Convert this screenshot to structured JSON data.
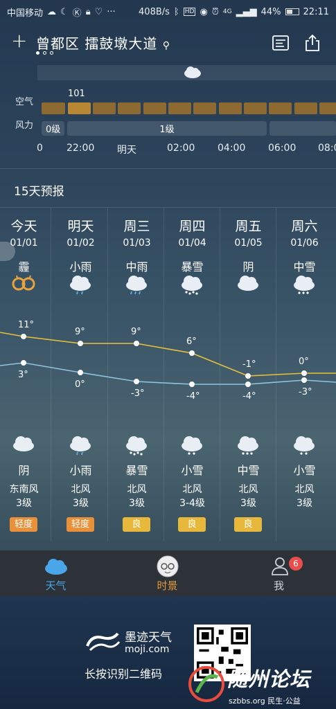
{
  "status_bar": {
    "carrier": "中国移动",
    "speed": "408B/s",
    "net": "4G",
    "battery": "44%",
    "time": "22:11",
    "battery_icon": "battery-icon"
  },
  "header": {
    "location": "曾都区 擂鼓墩大道",
    "add_label": "十"
  },
  "hourly": {
    "aq_label": "空气",
    "wind_label": "力风",
    "wind_label_display": "风力",
    "aqi_value": "101",
    "wind_levels": [
      "0级",
      "1级"
    ],
    "times": [
      "0",
      "22:00",
      "明天",
      "02:00",
      "04:00",
      "06:00",
      "08:0"
    ]
  },
  "forecast": {
    "title": "15天预报",
    "days": [
      {
        "day": "今天",
        "date": "01/01",
        "cond": "霾",
        "hi": "11°",
        "lo": "3°",
        "night": "阴",
        "wind_dir": "东南风",
        "wind_lv": "3级",
        "aqi": "轻度",
        "aqi_color": "#e9913a",
        "day_icon": "haze-icon",
        "night_icon": "cloud-icon"
      },
      {
        "day": "明天",
        "date": "01/02",
        "cond": "小雨",
        "hi": "9°",
        "lo": "0°",
        "night": "小雨",
        "wind_dir": "北风",
        "wind_lv": "3级",
        "aqi": "轻度",
        "aqi_color": "#e9913a",
        "day_icon": "light-rain-icon",
        "night_icon": "light-rain-icon"
      },
      {
        "day": "周三",
        "date": "01/03",
        "cond": "中雨",
        "hi": "9°",
        "lo": "-3°",
        "night": "暴雪",
        "wind_dir": "北风",
        "wind_lv": "3级",
        "aqi": "良",
        "aqi_color": "#e8b83c",
        "day_icon": "moderate-rain-icon",
        "night_icon": "blizzard-icon"
      },
      {
        "day": "周四",
        "date": "01/04",
        "cond": "暴雪",
        "hi": "6°",
        "lo": "-4°",
        "night": "小雪",
        "wind_dir": "北风",
        "wind_lv": "3-4级",
        "aqi": "良",
        "aqi_color": "#e8b83c",
        "day_icon": "blizzard-icon",
        "night_icon": "light-snow-icon"
      },
      {
        "day": "周五",
        "date": "01/05",
        "cond": "阴",
        "hi": "-1°",
        "lo": "-4°",
        "night": "中雪",
        "wind_dir": "北风",
        "wind_lv": "3级",
        "aqi": "良",
        "aqi_color": "#e8b83c",
        "day_icon": "cloud-icon",
        "night_icon": "moderate-snow-icon"
      },
      {
        "day": "周六",
        "date": "01/06",
        "cond": "中雪",
        "hi": "0°",
        "lo": "-3°",
        "night": "小雪",
        "wind_dir": "北风",
        "wind_lv": "3级",
        "aqi": "",
        "aqi_color": "",
        "day_icon": "moderate-snow-icon",
        "night_icon": "light-snow-icon"
      }
    ]
  },
  "tabs": [
    {
      "label": "天气",
      "color": "#4aa6e8"
    },
    {
      "label": "时景",
      "color": "#e69a3a"
    },
    {
      "label": "我",
      "color": "#cfd4d8",
      "badge": "6"
    }
  ],
  "footer": {
    "brand": "墨迹天气",
    "url": "moji.com",
    "scan_text": "长按识别二维码",
    "watermark": "随州论坛",
    "watermark_sub": "szbbs.org 民生·公益"
  }
}
